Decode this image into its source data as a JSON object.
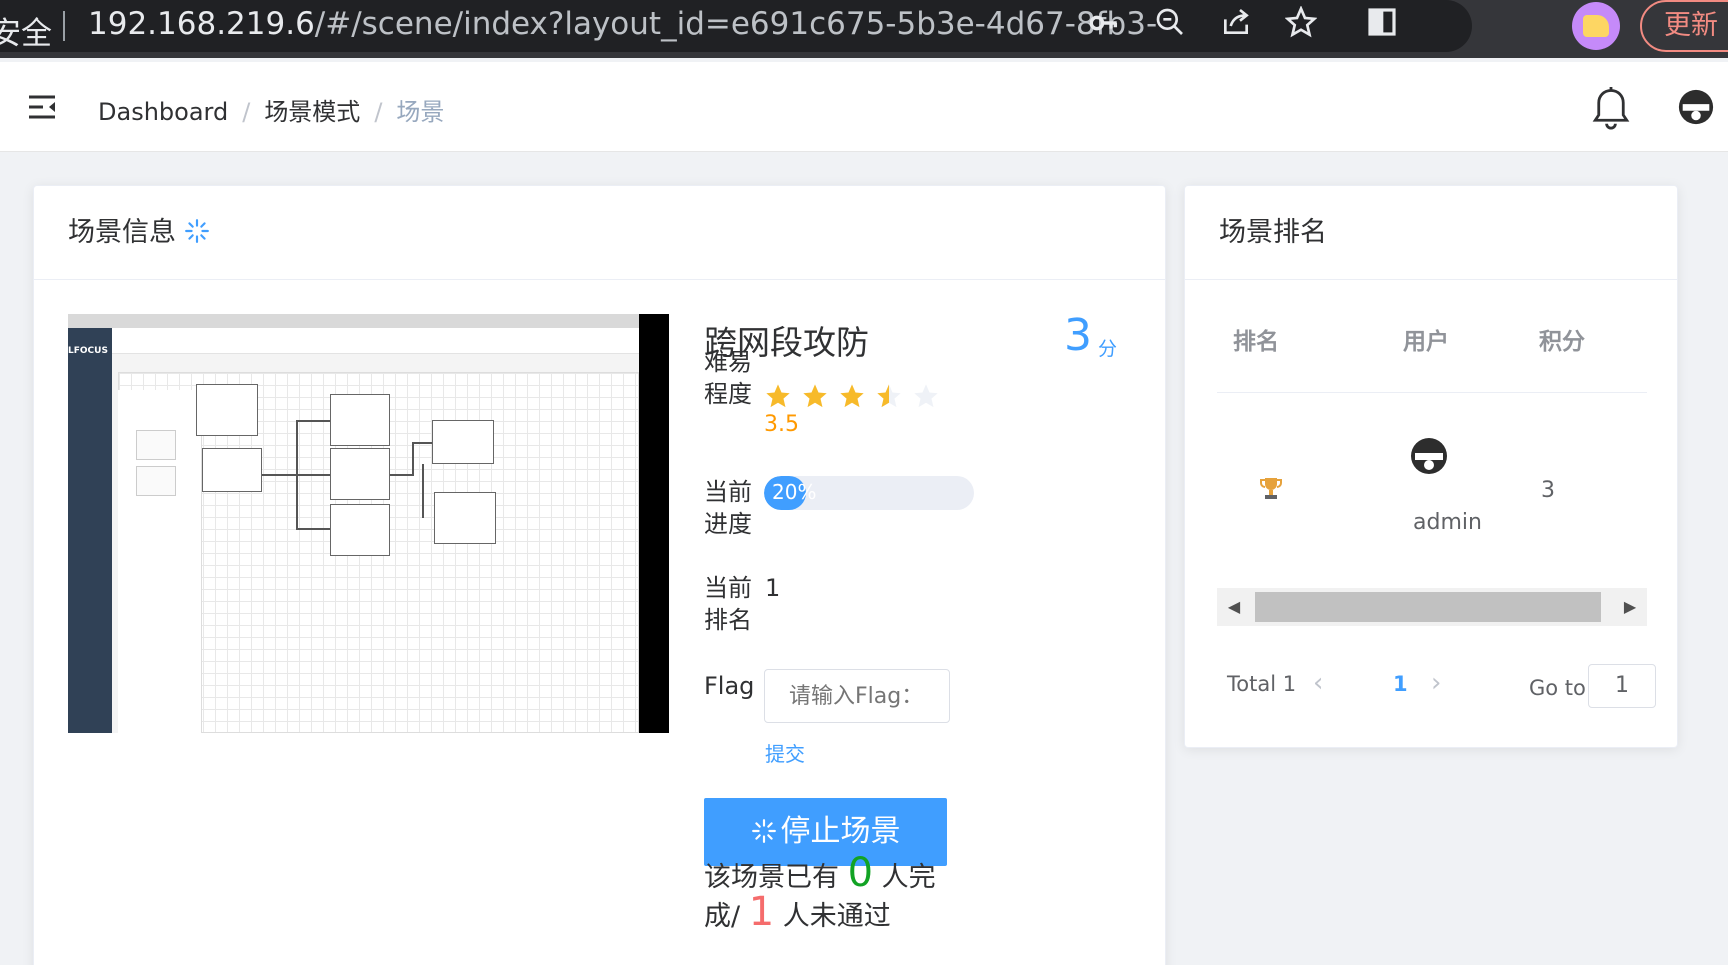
{
  "browser": {
    "security_label": "安全",
    "url_host": "192.168.219.6",
    "url_rest": "/#/scene/index?layout_id=e691c675-5b3e-4d67-8fb3-c...",
    "update_label": "更新"
  },
  "navbar": {
    "breadcrumbs": [
      "Dashboard",
      "场景模式",
      "场景"
    ]
  },
  "scene_card": {
    "header_title": "场景信息",
    "scene_name": "跨网段攻防",
    "score_value": "3",
    "score_unit": "分",
    "difficulty_label": "难易程度",
    "difficulty_rating": 3.5,
    "difficulty_text": "3.5",
    "progress_label": "当前进度",
    "progress_percent": 20,
    "progress_text": "20%",
    "rank_label": "当前排名",
    "rank_value": "1",
    "flag_label": "Flag",
    "flag_placeholder": "请输入Flag：",
    "submit_label": "提交",
    "stop_button_label": "停止场景",
    "stat_prefix": "该场景已有",
    "completed_count": "0",
    "completed_suffix": "人完成/",
    "failed_count": "1",
    "failed_suffix": "人未通过",
    "screenshot_logo": "LFOCUS"
  },
  "ranking_card": {
    "header_title": "场景排名",
    "columns": [
      "排名",
      "用户",
      "积分"
    ],
    "rows": [
      {
        "user": "admin",
        "score": "3"
      }
    ],
    "pagination": {
      "total_label": "Total 1",
      "current_page": "1",
      "goto_label": "Go to",
      "goto_value": "1"
    }
  },
  "colors": {
    "primary": "#409eff",
    "star": "#f7ba2a",
    "star_off": "#eff2f7",
    "rating_text": "#ff9900",
    "success": "#12a324",
    "danger": "#f56c6c"
  }
}
